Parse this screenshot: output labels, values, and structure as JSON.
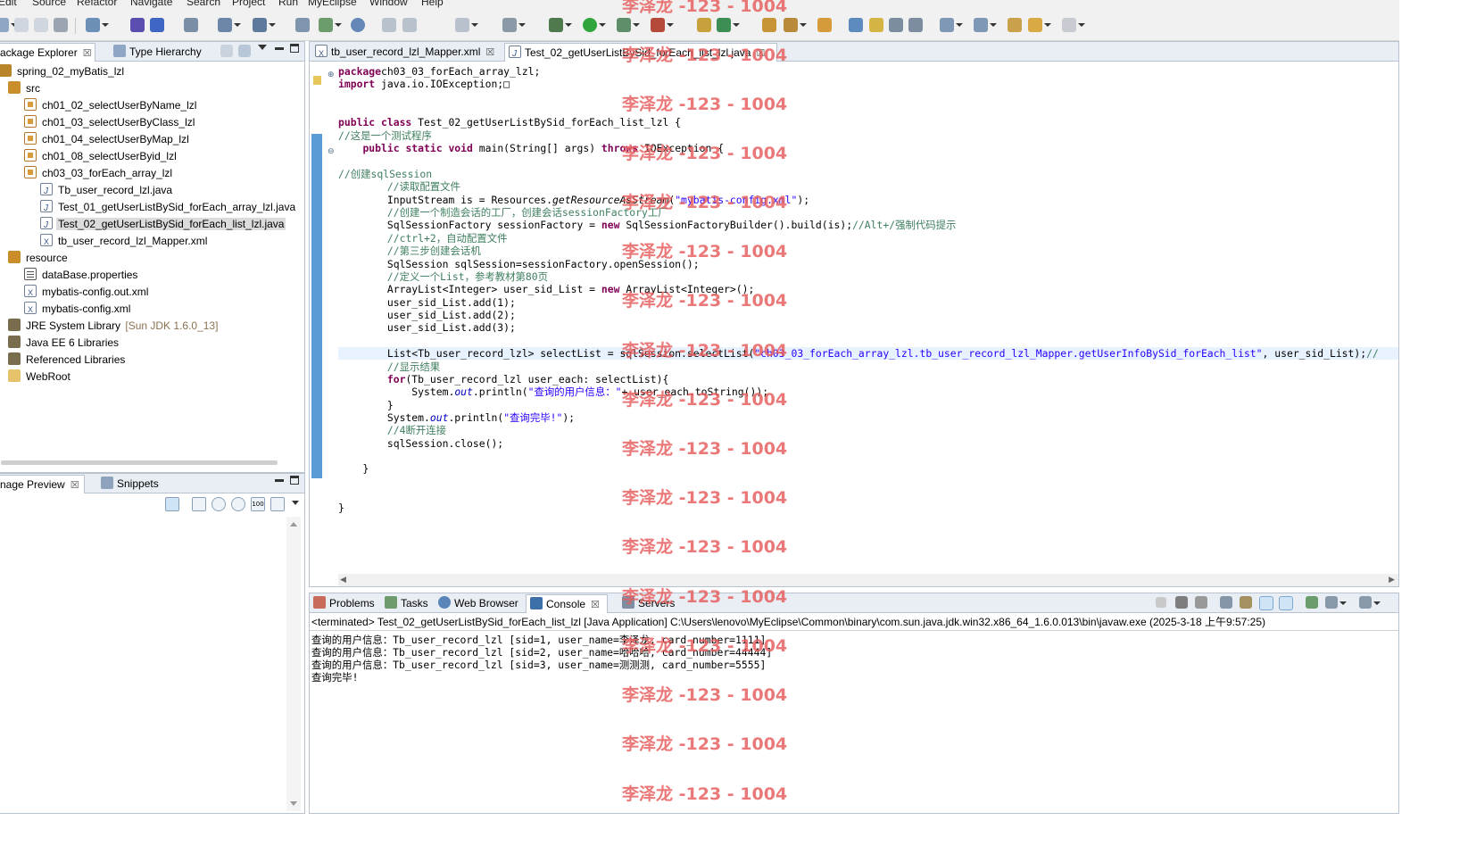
{
  "menu": [
    "Edit",
    "Source",
    "Refactor",
    "Navigate",
    "Search",
    "Project",
    "Run",
    "MyEclipse",
    "Window",
    "Help"
  ],
  "explorer": {
    "tabs": [
      {
        "label": "ackage Explorer",
        "close": "☒"
      },
      {
        "label": "Type Hierarchy"
      }
    ],
    "tree": [
      {
        "label": "spring_02_myBatis_lzl",
        "icon": "project-icon",
        "depth": 0
      },
      {
        "label": "src",
        "icon": "source-folder-icon",
        "depth": 1
      },
      {
        "label": "ch01_02_selectUserByName_lzl",
        "icon": "package-icon",
        "depth": 2
      },
      {
        "label": "ch01_03_selectUserByClass_lzl",
        "icon": "package-icon",
        "depth": 2
      },
      {
        "label": "ch01_04_selectUserByMap_lzl",
        "icon": "package-icon",
        "depth": 2
      },
      {
        "label": "ch01_08_selectUserByid_lzl",
        "icon": "package-icon",
        "depth": 2
      },
      {
        "label": "ch03_03_forEach_array_lzl",
        "icon": "package-icon",
        "depth": 2
      },
      {
        "label": "Tb_user_record_lzl.java",
        "icon": "java-file-icon",
        "depth": 3
      },
      {
        "label": "Test_01_getUserListBySid_forEach_array_lzl.java",
        "icon": "java-file-icon",
        "depth": 3
      },
      {
        "label": "Test_02_getUserListBySid_forEach_list_lzl.java",
        "icon": "java-file-icon",
        "depth": 3,
        "selected": true
      },
      {
        "label": "tb_user_record_lzl_Mapper.xml",
        "icon": "xml-file-icon",
        "depth": 3
      },
      {
        "label": "resource",
        "icon": "source-folder-icon",
        "depth": 1
      },
      {
        "label": "dataBase.properties",
        "icon": "properties-file-icon",
        "depth": 2
      },
      {
        "label": "mybatis-config.out.xml",
        "icon": "xml-file-icon",
        "depth": 2
      },
      {
        "label": "mybatis-config.xml",
        "icon": "xml-file-icon",
        "depth": 2
      },
      {
        "label": "JRE System Library",
        "suffix": "[Sun JDK 1.6.0_13]",
        "icon": "library-icon",
        "depth": 1
      },
      {
        "label": "Java EE 6 Libraries",
        "icon": "library-icon",
        "depth": 1
      },
      {
        "label": "Referenced Libraries",
        "icon": "library-icon",
        "depth": 1
      },
      {
        "label": "WebRoot",
        "icon": "folder-icon",
        "depth": 1
      }
    ]
  },
  "preview": {
    "tabs": [
      {
        "label": "nage Preview",
        "close": "☒"
      },
      {
        "label": "Snippets"
      }
    ],
    "zoom_label": "100"
  },
  "editor": {
    "tabs": [
      {
        "label": "tb_user_record_lzl_Mapper.xml",
        "close": "☒"
      },
      {
        "label": "Test_02_getUserListBySid_forEach_list_lzl.java",
        "close": "☒",
        "active": true
      }
    ]
  },
  "code": [
    {
      "segs": [
        [
          "kw",
          "package"
        ],
        [
          "",
          "ch03_03_forEach_array_lzl;"
        ]
      ]
    },
    {
      "segs": [
        [
          "kw",
          "import"
        ],
        [
          "",
          " java.io.IOException;"
        ],
        [
          "",
          "□"
        ]
      ]
    },
    {
      "segs": []
    },
    {
      "segs": []
    },
    {
      "segs": [
        [
          "kw",
          "public class"
        ],
        [
          "",
          " Test_02_getUserListBySid_forEach_list_lzl {"
        ]
      ]
    },
    {
      "segs": [
        [
          "cm",
          "//这是一个测试程序"
        ]
      ]
    },
    {
      "segs": [
        [
          "",
          "    "
        ],
        [
          "kw",
          "public static void"
        ],
        [
          "",
          " main(String[] args) "
        ],
        [
          "kw",
          "throws"
        ],
        [
          "",
          " IOException {"
        ]
      ]
    },
    {
      "segs": []
    },
    {
      "segs": [
        [
          "cm",
          "//创建sqlSession"
        ]
      ]
    },
    {
      "segs": [
        [
          "",
          "        "
        ],
        [
          "cm",
          "//读取配置文件"
        ]
      ]
    },
    {
      "segs": [
        [
          "",
          "        InputStream is = Resources."
        ],
        [
          "it",
          "getResourceAsStream"
        ],
        [
          "",
          "("
        ],
        [
          "st",
          "\"mybatis-config.xml\""
        ],
        [
          "",
          ");"
        ]
      ]
    },
    {
      "segs": [
        [
          "",
          "        "
        ],
        [
          "cm",
          "//创建一个制造会话的工厂，创建会话sessionFactory工厂"
        ]
      ]
    },
    {
      "segs": [
        [
          "",
          "        SqlSessionFactory sessionFactory = "
        ],
        [
          "kw",
          "new"
        ],
        [
          "",
          " SqlSessionFactoryBuilder().build(is);"
        ],
        [
          "cm",
          "//Alt+/强制代码提示"
        ]
      ]
    },
    {
      "segs": [
        [
          "",
          "        "
        ],
        [
          "cm",
          "//ctrl+2，自动配置文件"
        ]
      ]
    },
    {
      "segs": [
        [
          "",
          "        "
        ],
        [
          "cm",
          "//第三步创建会话机"
        ]
      ]
    },
    {
      "segs": [
        [
          "",
          "        SqlSession sqlSession=sessionFactory.openSession();"
        ]
      ]
    },
    {
      "segs": [
        [
          "",
          "        "
        ],
        [
          "cm",
          "//定义一个List，参考教材第80页"
        ]
      ]
    },
    {
      "segs": [
        [
          "",
          "        ArrayList<Integer> user_sid_List = "
        ],
        [
          "kw",
          "new"
        ],
        [
          "",
          " ArrayList<Integer>();"
        ]
      ]
    },
    {
      "segs": [
        [
          "",
          "        user_sid_List.add(1);"
        ]
      ]
    },
    {
      "segs": [
        [
          "",
          "        user_sid_List.add(2);"
        ]
      ]
    },
    {
      "segs": [
        [
          "",
          "        user_sid_List.add(3);"
        ]
      ]
    },
    {
      "segs": []
    },
    {
      "segs": [
        [
          "",
          "        List<Tb_user_record_lzl> selectList = sqlSession.selectList("
        ],
        [
          "st",
          "\"ch03_03_forEach_array_lzl.tb_user_record_lzl_Mapper.getUserInfoBySid_forEach_list\""
        ],
        [
          "",
          ", user_sid_List);"
        ],
        [
          "cm",
          "//"
        ]
      ],
      "highlight": true
    },
    {
      "segs": [
        [
          "",
          "        "
        ],
        [
          "cm",
          "//显示结果"
        ]
      ]
    },
    {
      "segs": [
        [
          "",
          "        "
        ],
        [
          "kw",
          "for"
        ],
        [
          "",
          "(Tb_user_record_lzl user_each: selectList){"
        ]
      ]
    },
    {
      "segs": [
        [
          "",
          "            System."
        ],
        [
          "fld",
          "out"
        ],
        [
          "",
          ".println("
        ],
        [
          "st",
          "\"查询的用户信息：\""
        ],
        [
          "",
          "+ user_each.toString());"
        ]
      ]
    },
    {
      "segs": [
        [
          "",
          "        }"
        ]
      ]
    },
    {
      "segs": [
        [
          "",
          "        System."
        ],
        [
          "fld",
          "out"
        ],
        [
          "",
          ".println("
        ],
        [
          "st",
          "\"查询完毕!\""
        ],
        [
          "",
          ");"
        ]
      ]
    },
    {
      "segs": [
        [
          "",
          "        "
        ],
        [
          "cm",
          "//4断开连接"
        ]
      ]
    },
    {
      "segs": [
        [
          "",
          "        sqlSession.close();"
        ]
      ]
    },
    {
      "segs": []
    },
    {
      "segs": [
        [
          "",
          "    }"
        ]
      ]
    },
    {
      "segs": []
    },
    {
      "segs": []
    },
    {
      "segs": [
        [
          "",
          "}"
        ]
      ]
    }
  ],
  "console": {
    "tabs": [
      {
        "label": "Problems"
      },
      {
        "label": "Tasks"
      },
      {
        "label": "Web Browser"
      },
      {
        "label": "Console",
        "close": "☒",
        "active": true
      },
      {
        "label": "Servers"
      }
    ],
    "header": "<terminated> Test_02_getUserListBySid_forEach_list_lzl [Java Application] C:\\Users\\lenovo\\MyEclipse\\Common\\binary\\com.sun.java.jdk.win32.x86_64_1.6.0.013\\bin\\javaw.exe (2025-3-18 上午9:57:25)",
    "output": [
      "查询的用户信息：Tb_user_record_lzl [sid=1, user_name=李泽龙, card_number=1111]",
      "查询的用户信息：Tb_user_record_lzl [sid=2, user_name=哈哈哈, card_number=44444]",
      "查询的用户信息：Tb_user_record_lzl [sid=3, user_name=测测测, card_number=5555]",
      "查询完毕!"
    ]
  },
  "watermark": "李泽龙 -123 - 1004",
  "colors": {
    "keyword": "#7f0055",
    "comment": "#3f7f5f",
    "string": "#2a00ff",
    "watermark": "#e65a5a",
    "selection": "#dcdcdc",
    "current_line": "#e8f2fe"
  }
}
